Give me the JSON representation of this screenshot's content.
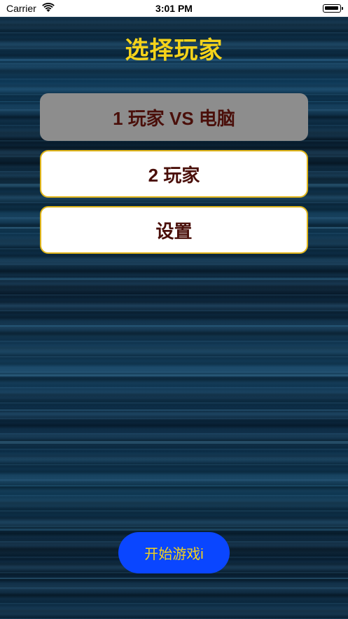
{
  "status_bar": {
    "carrier": "Carrier",
    "time": "3:01 PM",
    "icons": [
      "wifi-icon",
      "battery-icon"
    ]
  },
  "screen": {
    "title": "选择玩家",
    "menu": {
      "vs_computer_label": "1 玩家 VS 电脑",
      "two_player_label": "2 玩家",
      "settings_label": "设置"
    },
    "start_button_label": "开始游戏i"
  },
  "colors": {
    "title": "#f5d31a",
    "button_text": "#4a0f0a",
    "button_border": "#e0b51a",
    "selected_button_bg": "#8d8d8d",
    "start_button_bg": "#0a46ff",
    "start_button_text": "#f5d31a"
  }
}
